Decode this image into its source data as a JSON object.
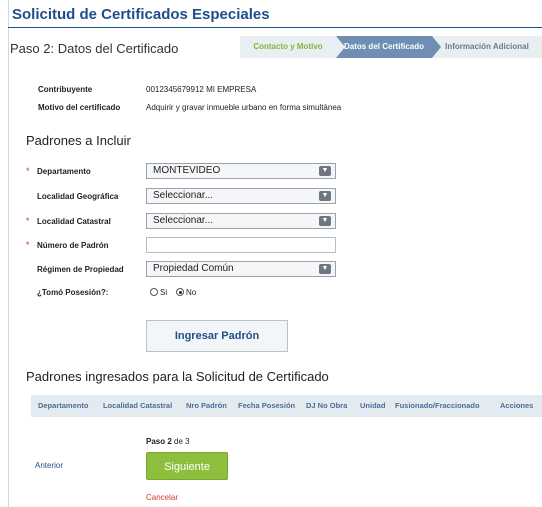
{
  "page": {
    "title": "Solicitud de Certificados Especiales",
    "step_label": "Paso 2: Datos del Certificado"
  },
  "wizard": {
    "steps": [
      "Contacto y Motivo",
      "Datos del Certificado",
      "Información Adicional"
    ],
    "active_index": 1
  },
  "info": {
    "contribuyente_label": "Contribuyente",
    "contribuyente_value": "0012345679912 MI EMPRESA",
    "motivo_label": "Motivo del certificado",
    "motivo_value": "Adquirir y gravar inmueble urbano en forma simultánea"
  },
  "padrones_section": {
    "title": "Padrones a Incluir"
  },
  "form": {
    "required_mark": "*",
    "departamento": {
      "label": "Departamento",
      "value": "MONTEVIDEO"
    },
    "localidad_geografica": {
      "label": "Localidad Geográfica",
      "value": "Seleccionar..."
    },
    "localidad_catastral": {
      "label": "Localidad Catastral",
      "value": "Seleccionar..."
    },
    "numero_padron": {
      "label": "Número de Padrón",
      "value": ""
    },
    "regimen": {
      "label": "Régimen de Propiedad",
      "value": "Propiedad Común"
    },
    "posesion": {
      "label": "¿Tomó Posesión?:",
      "options": [
        "Si",
        "No"
      ],
      "selected": "No"
    },
    "caret_icon": "▼"
  },
  "ingresar_button": "Ingresar Padrón",
  "ingresados": {
    "title": "Padrones ingresados para la Solicitud de Certificado",
    "columns": [
      "Departamento",
      "Localidad Catastral",
      "Nro Padrón",
      "Fecha Posesión",
      "DJ No Obra",
      "Unidad",
      "Fusionado/Fraccionado",
      "Acciones"
    ]
  },
  "footer": {
    "paso_prefix": "Paso",
    "paso_current": "2",
    "paso_suffix": "de 3",
    "anterior": "Anterior",
    "siguiente": "Siguiente",
    "cancelar": "Cancelar"
  }
}
